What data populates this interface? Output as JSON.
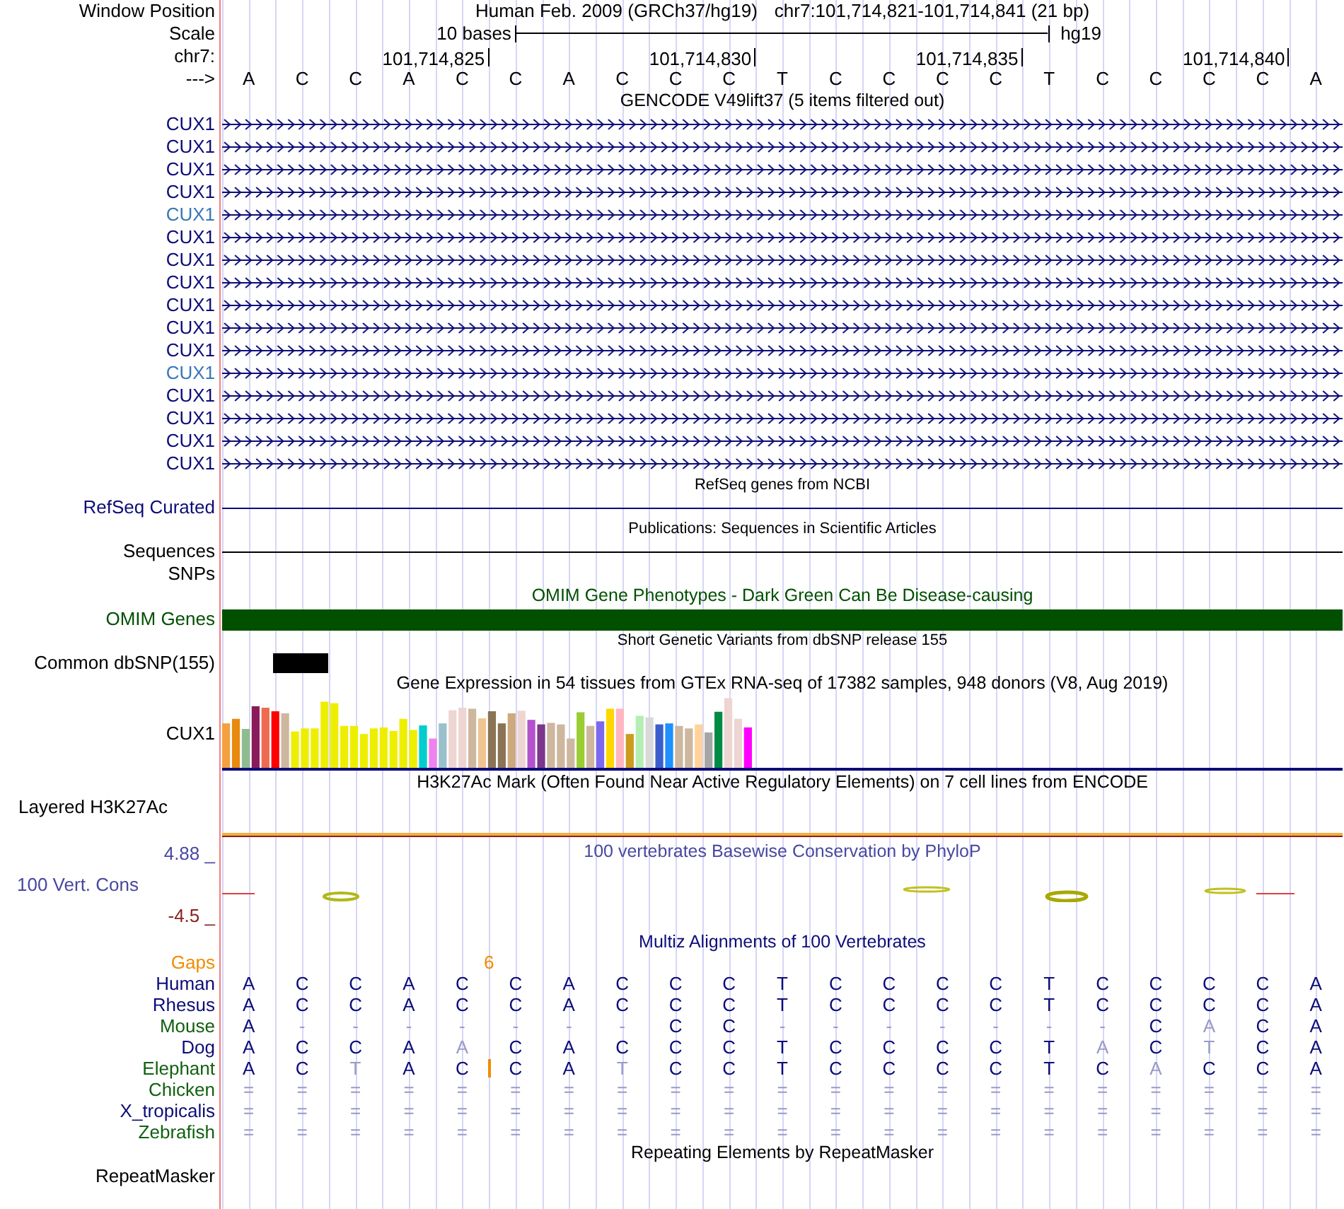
{
  "position": {
    "label": "Window Position",
    "assembly": "Human Feb. 2009 (GRCh37/hg19)",
    "range": "chr7:101,714,821-101,714,841 (21 bp)"
  },
  "scale": {
    "label": "Scale",
    "size": "10 bases",
    "db": "hg19"
  },
  "ruler": {
    "label": "chr7:",
    "ticks": [
      "101,714,825",
      "101,714,830",
      "101,714,835",
      "101,714,840"
    ]
  },
  "sequence": {
    "label": "--->",
    "bases": [
      "A",
      "C",
      "C",
      "A",
      "C",
      "C",
      "A",
      "C",
      "C",
      "C",
      "T",
      "C",
      "C",
      "C",
      "C",
      "T",
      "C",
      "C",
      "C",
      "C",
      "A"
    ]
  },
  "tracks": [
    {
      "kind": "genes",
      "title": "GENCODE V49lift37 (5 items filtered out)",
      "genes": [
        {
          "name": "CUX1",
          "color": "#0c0c78"
        },
        {
          "name": "CUX1",
          "color": "#0c0c78"
        },
        {
          "name": "CUX1",
          "color": "#0c0c78"
        },
        {
          "name": "CUX1",
          "color": "#0c0c78"
        },
        {
          "name": "CUX1",
          "color": "#3a78b8"
        },
        {
          "name": "CUX1",
          "color": "#0c0c78"
        },
        {
          "name": "CUX1",
          "color": "#0c0c78"
        },
        {
          "name": "CUX1",
          "color": "#0c0c78"
        },
        {
          "name": "CUX1",
          "color": "#0c0c78"
        },
        {
          "name": "CUX1",
          "color": "#0c0c78"
        },
        {
          "name": "CUX1",
          "color": "#0c0c78"
        },
        {
          "name": "CUX1",
          "color": "#3a78b8"
        },
        {
          "name": "CUX1",
          "color": "#0c0c78"
        },
        {
          "name": "CUX1",
          "color": "#0c0c78"
        },
        {
          "name": "CUX1",
          "color": "#0c0c78"
        },
        {
          "name": "CUX1",
          "color": "#0c0c78"
        }
      ]
    },
    {
      "kind": "line",
      "title": "RefSeq genes from NCBI",
      "label": "RefSeq Curated",
      "color": "#0c0c78"
    },
    {
      "kind": "line",
      "title": "Publications: Sequences in Scientific Articles",
      "label": "Sequences",
      "color": "#000000"
    },
    {
      "kind": "label",
      "label": "SNPs"
    },
    {
      "kind": "bar",
      "title": "OMIM Gene Phenotypes - Dark Green Can Be Disease-causing",
      "label": "OMIM Genes",
      "color": "#005000"
    },
    {
      "kind": "snp",
      "title": "Short Genetic Variants from dbSNP release 155",
      "label": "Common dbSNP(155)"
    },
    {
      "kind": "expression",
      "title": "Gene Expression in 54 tissues from GTEx RNA-seq of 17382 samples, 948 donors (V8, Aug 2019)",
      "label": "CUX1"
    },
    {
      "kind": "signal",
      "title": "H3K27Ac Mark (Often Found Near Active Regulatory Elements) on 7 cell lines from ENCODE",
      "label": "Layered H3K27Ac"
    },
    {
      "kind": "conservation",
      "title": "100 vertebrates Basewise Conservation by PhyloP",
      "label": "100 Vert. Cons",
      "max": "4.88 _",
      "min": "-4.5 _",
      "color": "#4848a0"
    },
    {
      "kind": "alignment",
      "title": "Multiz Alignments of 100 Vertebrates",
      "color": "#0c0c78",
      "gaps": {
        "label": "Gaps",
        "count": "6"
      },
      "species": [
        {
          "name": "Human",
          "color": "#0c0c78",
          "bases": [
            "A",
            "C",
            "C",
            "A",
            "C",
            "C",
            "A",
            "C",
            "C",
            "C",
            "T",
            "C",
            "C",
            "C",
            "C",
            "T",
            "C",
            "C",
            "C",
            "C",
            "A"
          ],
          "mismatch": [
            false,
            false,
            false,
            false,
            false,
            false,
            false,
            false,
            false,
            false,
            false,
            false,
            false,
            false,
            false,
            false,
            false,
            false,
            false,
            false,
            false
          ],
          "insertion": false
        },
        {
          "name": "Rhesus",
          "color": "#0c0c78",
          "bases": [
            "A",
            "C",
            "C",
            "A",
            "C",
            "C",
            "A",
            "C",
            "C",
            "C",
            "T",
            "C",
            "C",
            "C",
            "C",
            "T",
            "C",
            "C",
            "C",
            "C",
            "A"
          ],
          "mismatch": [
            false,
            false,
            false,
            false,
            false,
            false,
            false,
            false,
            false,
            false,
            false,
            false,
            false,
            false,
            false,
            false,
            false,
            false,
            false,
            false,
            false
          ],
          "insertion": false
        },
        {
          "name": "Mouse",
          "color": "#106010",
          "bases": [
            "A",
            "-",
            "-",
            "-",
            "-",
            "-",
            "-",
            "-",
            "C",
            "C",
            "-",
            "-",
            "-",
            "-",
            "-",
            "-",
            "-",
            "C",
            "A",
            "C",
            "A"
          ],
          "mismatch": [
            false,
            true,
            true,
            true,
            true,
            true,
            true,
            true,
            false,
            false,
            true,
            true,
            true,
            true,
            true,
            true,
            true,
            false,
            true,
            false,
            false
          ],
          "insertion": false
        },
        {
          "name": "Dog",
          "color": "#0c0c78",
          "bases": [
            "A",
            "C",
            "C",
            "A",
            "A",
            "C",
            "A",
            "C",
            "C",
            "C",
            "T",
            "C",
            "C",
            "C",
            "C",
            "T",
            "A",
            "C",
            "T",
            "C",
            "A"
          ],
          "mismatch": [
            false,
            false,
            false,
            false,
            true,
            false,
            false,
            false,
            false,
            false,
            false,
            false,
            false,
            false,
            false,
            false,
            true,
            false,
            true,
            false,
            false
          ],
          "insertion": false
        },
        {
          "name": "Elephant",
          "color": "#106010",
          "bases": [
            "A",
            "C",
            "T",
            "A",
            "C",
            "C",
            "A",
            "T",
            "C",
            "C",
            "T",
            "C",
            "C",
            "C",
            "C",
            "T",
            "C",
            "A",
            "C",
            "C",
            "A"
          ],
          "mismatch": [
            false,
            false,
            true,
            false,
            false,
            false,
            false,
            true,
            false,
            false,
            false,
            false,
            false,
            false,
            false,
            false,
            false,
            true,
            false,
            false,
            false
          ],
          "insertion": true
        },
        {
          "name": "Chicken",
          "color": "#106010",
          "bases": [
            "=",
            "=",
            "=",
            "=",
            "=",
            "=",
            "=",
            "=",
            "=",
            "=",
            "=",
            "=",
            "=",
            "=",
            "=",
            "=",
            "=",
            "=",
            "=",
            "=",
            "="
          ],
          "mismatch": [
            true,
            true,
            true,
            true,
            true,
            true,
            true,
            true,
            true,
            true,
            true,
            true,
            true,
            true,
            true,
            true,
            true,
            true,
            true,
            true,
            true
          ],
          "insertion": false
        },
        {
          "name": "X_tropicalis",
          "color": "#0c0c78",
          "bases": [
            "=",
            "=",
            "=",
            "=",
            "=",
            "=",
            "=",
            "=",
            "=",
            "=",
            "=",
            "=",
            "=",
            "=",
            "=",
            "=",
            "=",
            "=",
            "=",
            "=",
            "="
          ],
          "mismatch": [
            true,
            true,
            true,
            true,
            true,
            true,
            true,
            true,
            true,
            true,
            true,
            true,
            true,
            true,
            true,
            true,
            true,
            true,
            true,
            true,
            true
          ],
          "insertion": false
        },
        {
          "name": "Zebrafish",
          "color": "#106010",
          "bases": [
            "=",
            "=",
            "=",
            "=",
            "=",
            "=",
            "=",
            "=",
            "=",
            "=",
            "=",
            "=",
            "=",
            "=",
            "=",
            "=",
            "=",
            "=",
            "=",
            "=",
            "="
          ],
          "mismatch": [
            true,
            true,
            true,
            true,
            true,
            true,
            true,
            true,
            true,
            true,
            true,
            true,
            true,
            true,
            true,
            true,
            true,
            true,
            true,
            true,
            true
          ],
          "insertion": false
        }
      ]
    },
    {
      "kind": "titled",
      "title": "Repeating Elements by RepeatMasker",
      "label": "RepeatMasker"
    }
  ]
}
